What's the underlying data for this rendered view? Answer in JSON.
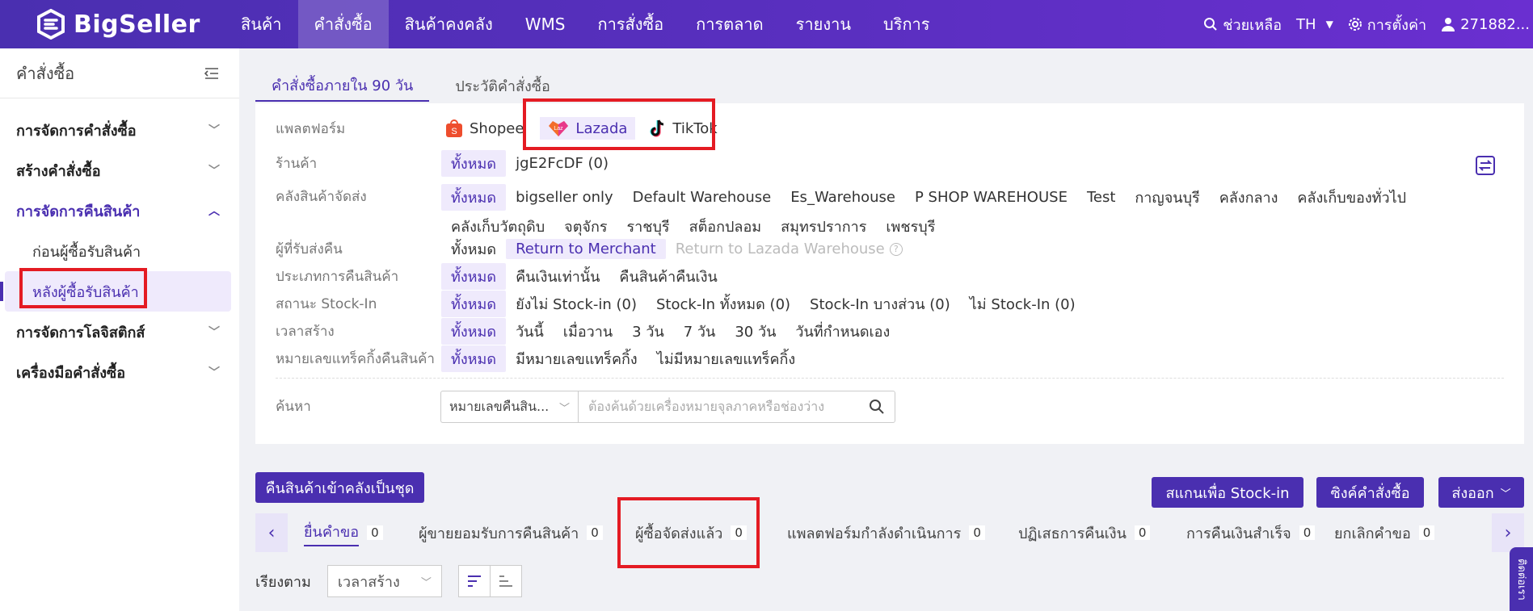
{
  "app": {
    "logo_text": "BigSeller"
  },
  "nav": {
    "items": [
      "สินค้า",
      "คำสั่งซื้อ",
      "สินค้าคงคลัง",
      "WMS",
      "การสั่งซื้อ",
      "การตลาด",
      "รายงาน",
      "บริการ"
    ],
    "active_index": 1
  },
  "topright": {
    "help": "ช่วยเหลือ",
    "lang": "TH",
    "settings": "การตั้งค่า",
    "user": "271882..."
  },
  "sidebar": {
    "title": "คำสั่งซื้อ",
    "groups": [
      "การจัดการคำสั่งซื้อ",
      "สร้างคำสั่งซื้อ",
      "การจัดการคืนสินค้า",
      "การจัดการโลจิสติกส์",
      "เครื่องมือคำสั่งซื้อ"
    ],
    "subitems": [
      "ก่อนผู้ซื้อรับสินค้า",
      "หลังผู้ซื้อรับสินค้า"
    ]
  },
  "tabs": [
    "คำสั่งซื้อภายใน 90 วัน",
    "ประวัติคำสั่งซื้อ"
  ],
  "filters": {
    "platform": {
      "label": "แพลตฟอร์ม",
      "options": [
        "Shopee",
        "Lazada",
        "TikTok"
      ],
      "selected": "Lazada"
    },
    "store": {
      "label": "ร้านค้า",
      "options": [
        "ทั้งหมด",
        "jgE2FcDF (0)"
      ]
    },
    "warehouse": {
      "label": "คลังสินค้าจัดส่ง",
      "options": [
        "ทั้งหมด",
        "bigseller only",
        "Default Warehouse",
        "Es_Warehouse",
        "P SHOP WAREHOUSE",
        "Test",
        "กาญจนบุรี",
        "คลังกลาง",
        "คลังเก็บของทั่วไป",
        "คลังเก็บวัตถุดิบ",
        "จตุจักร",
        "ราชบุรี",
        "สต็อกปลอม",
        "สมุทรปราการ",
        "เพชรบุรี"
      ]
    },
    "recipient": {
      "label": "ผู้ที่รับส่งคืน",
      "options": [
        "ทั้งหมด",
        "Return to Merchant",
        "Return to Lazada Warehouse"
      ]
    },
    "return_type": {
      "label": "ประเภทการคืนสินค้า",
      "options": [
        "ทั้งหมด",
        "คืนเงินเท่านั้น",
        "คืนสินค้าคืนเงิน"
      ]
    },
    "stockin": {
      "label": "สถานะ Stock-In",
      "options": [
        "ทั้งหมด",
        "ยังไม่ Stock-in (0)",
        "Stock-In ทั้งหมด (0)",
        "Stock-In บางส่วน (0)",
        "ไม่ Stock-In (0)"
      ]
    },
    "created": {
      "label": "เวลาสร้าง",
      "options": [
        "ทั้งหมด",
        "วันนี้",
        "เมื่อวาน",
        "3 วัน",
        "7 วัน",
        "30 วัน",
        "วันที่กำหนดเอง"
      ]
    },
    "tracking": {
      "label": "หมายเลขแทร็คกิ้งคืนสินค้า",
      "options": [
        "ทั้งหมด",
        "มีหมายเลขแทร็คกิ้ง",
        "ไม่มีหมายเลขแทร็คกิ้ง"
      ]
    },
    "search": {
      "label": "ค้นหา",
      "select_value": "หมายเลขคืนสิน...",
      "placeholder": "ต้องค้นด้วยเครื่องหมายจุลภาคหรือช่องว่าง"
    }
  },
  "actions": {
    "batch_stockin": "คืนสินค้าเข้าคลังเป็นชุด",
    "scan_stockin": "สแกนเพื่อ Stock-in",
    "sync_orders": "ซิงค์คำสั่งซื้อ",
    "export": "ส่งออก"
  },
  "status_tabs": [
    {
      "label": "ยื่นคำขอ",
      "count": "0"
    },
    {
      "label": "ผู้ขายยอมรับการคืนสินค้า",
      "count": "0"
    },
    {
      "label": "ผู้ซื้อจัดส่งแล้ว",
      "count": "0"
    },
    {
      "label": "แพลตฟอร์มกำลังดำเนินการ",
      "count": "0"
    },
    {
      "label": "ปฏิเสธการคืนเงิน",
      "count": "0"
    },
    {
      "label": "การคืนเงินสำเร็จ",
      "count": "0"
    },
    {
      "label": "ยกเลิกคำขอ",
      "count": "0"
    }
  ],
  "sort": {
    "label": "เรียงตาม",
    "value": "เวลาสร้าง"
  },
  "float_tab": "ติดต่อเรา",
  "colors": {
    "brand": "#4a2fb0",
    "highlight": "#e41b23"
  }
}
